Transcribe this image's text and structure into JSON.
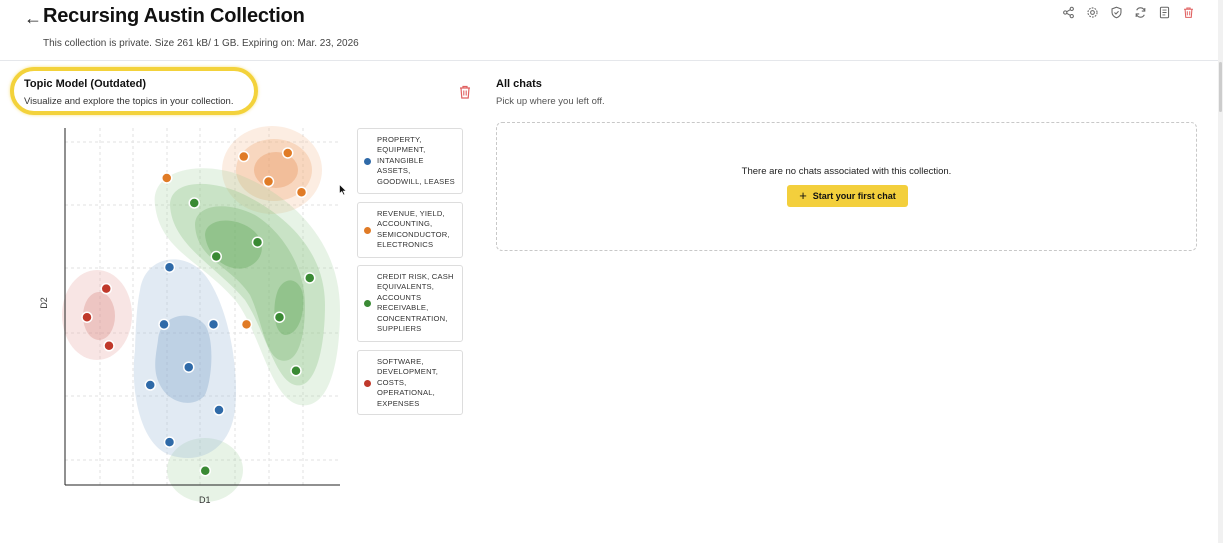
{
  "header": {
    "title": "Recursing Austin Collection",
    "subtitle": "This collection is private. Size 261 kB/ 1 GB. Expiring on: Mar. 23, 2026",
    "toolbar_icons": [
      "share-icon",
      "gear-icon",
      "shield-icon",
      "refresh-icon",
      "document-icon",
      "trash-icon"
    ]
  },
  "topic_model": {
    "title": "Topic Model (Outdated)",
    "description": "Visualize and explore the topics in your collection.",
    "x_label": "D1",
    "y_label": "D2",
    "legend": [
      {
        "label": "PROPERTY, EQUIPMENT, INTANGIBLE ASSETS, GOODWILL, LEASES",
        "color": "#2f6aa8"
      },
      {
        "label": "REVENUE, YIELD, ACCOUNTING, SEMICONDUCTOR, ELECTRONICS",
        "color": "#e07b26"
      },
      {
        "label": "CREDIT RISK, CASH EQUIVALENTS, ACCOUNTS RECEIVABLE, CONCENTRATION, SUPPLIERS",
        "color": "#3a8a34"
      },
      {
        "label": "SOFTWARE, DEVELOPMENT, COSTS, OPERATIONAL, EXPENSES",
        "color": "#c0392b"
      }
    ]
  },
  "chats": {
    "title": "All chats",
    "description": "Pick up where you left off.",
    "empty_message": "There are no chats associated with this collection.",
    "start_button": "Start your first chat"
  },
  "colors": {
    "accent": "#f3cf3c",
    "danger": "#e06060"
  },
  "chart_data": {
    "type": "scatter",
    "xlabel": "D1",
    "ylabel": "D2",
    "grid": true,
    "series": [
      {
        "name": "PROPERTY, EQUIPMENT, INTANGIBLE ASSETS, GOODWILL, LEASES",
        "color": "#2f6aa8",
        "points": [
          [
            0.38,
            0.61
          ],
          [
            0.36,
            0.45
          ],
          [
            0.54,
            0.45
          ],
          [
            0.45,
            0.33
          ],
          [
            0.31,
            0.28
          ],
          [
            0.56,
            0.21
          ],
          [
            0.38,
            0.12
          ]
        ]
      },
      {
        "name": "REVENUE, YIELD, ACCOUNTING, SEMICONDUCTOR, ELECTRONICS",
        "color": "#e07b26",
        "points": [
          [
            0.37,
            0.86
          ],
          [
            0.65,
            0.92
          ],
          [
            0.81,
            0.93
          ],
          [
            0.74,
            0.85
          ],
          [
            0.86,
            0.82
          ],
          [
            0.66,
            0.45
          ]
        ]
      },
      {
        "name": "CREDIT RISK, CASH EQUIVALENTS, ACCOUNTS RECEIVABLE, CONCENTRATION, SUPPLIERS",
        "color": "#3a8a34",
        "points": [
          [
            0.47,
            0.79
          ],
          [
            0.7,
            0.68
          ],
          [
            0.55,
            0.64
          ],
          [
            0.89,
            0.58
          ],
          [
            0.78,
            0.47
          ],
          [
            0.84,
            0.32
          ],
          [
            0.51,
            0.04
          ]
        ]
      },
      {
        "name": "SOFTWARE, DEVELOPMENT, COSTS, OPERATIONAL, EXPENSES",
        "color": "#c0392b",
        "points": [
          [
            0.15,
            0.55
          ],
          [
            0.08,
            0.47
          ],
          [
            0.16,
            0.39
          ]
        ]
      }
    ]
  }
}
